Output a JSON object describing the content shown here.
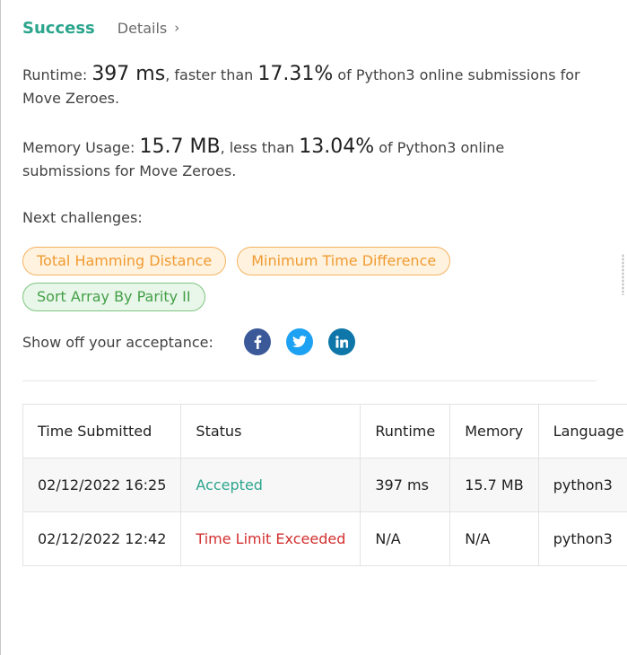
{
  "header": {
    "status_label": "Success",
    "details_label": "Details",
    "details_chevron": "›"
  },
  "runtime": {
    "label": "Runtime:",
    "value": "397 ms",
    "mid": ", faster than",
    "percent": "17.31%",
    "suffix": "of Python3 online submissions for Move Zeroes."
  },
  "memory": {
    "label": "Memory Usage:",
    "value": "15.7 MB",
    "mid": ", less than",
    "percent": "13.04%",
    "suffix": "of Python3 online submissions for Move Zeroes."
  },
  "challenges": {
    "title": "Next challenges:",
    "items": [
      {
        "label": "Total Hamming Distance",
        "difficulty": "medium"
      },
      {
        "label": "Minimum Time Difference",
        "difficulty": "medium"
      },
      {
        "label": "Sort Array By Parity II",
        "difficulty": "easy"
      }
    ]
  },
  "share": {
    "label": "Show off your acceptance:",
    "icons": [
      "facebook-icon",
      "twitter-icon",
      "linkedin-icon"
    ]
  },
  "submissions": {
    "headers": [
      "Time Submitted",
      "Status",
      "Runtime",
      "Memory",
      "Language"
    ],
    "rows": [
      {
        "time": "02/12/2022 16:25",
        "status": "Accepted",
        "runtime": "397 ms",
        "memory": "15.7 MB",
        "language": "python3"
      },
      {
        "time": "02/12/2022 12:42",
        "status": "Time Limit Exceeded",
        "runtime": "N/A",
        "memory": "N/A",
        "language": "python3"
      }
    ]
  },
  "colors": {
    "success": "#2ca58d",
    "error": "#d32f2f",
    "medium_chip": "#f09a30",
    "easy_chip": "#43a047",
    "facebook": "#3b5998",
    "twitter": "#1da1f2",
    "linkedin": "#0e76a8"
  }
}
